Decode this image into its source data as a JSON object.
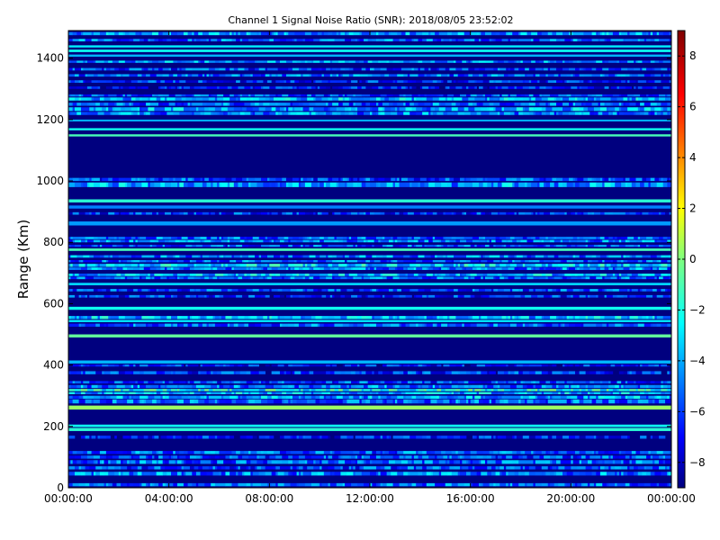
{
  "chart_data": {
    "type": "heatmap",
    "title": "Channel 1 Signal Noise Ratio (SNR): 2018/08/05 23:52:02",
    "xlabel": "",
    "ylabel": "Range (Km)",
    "x_tick_labels": [
      "00:00:00",
      "04:00:00",
      "08:00:00",
      "12:00:00",
      "16:00:00",
      "20:00:00",
      "00:00:00"
    ],
    "x_ticks_hours": [
      0,
      4,
      8,
      12,
      16,
      20,
      24
    ],
    "xlim_hours": [
      0,
      24
    ],
    "y_ticks": [
      0,
      200,
      400,
      600,
      800,
      1000,
      1200,
      1400
    ],
    "ylim": [
      0,
      1490
    ],
    "colorbar": {
      "colormap": "jet",
      "clim": [
        -9,
        9
      ],
      "ticks": [
        8,
        6,
        4,
        2,
        0,
        -2,
        -4,
        -6,
        -8
      ],
      "tick_labels": [
        "8",
        "6",
        "4",
        "2",
        "0",
        "−2",
        "−4",
        "−6",
        "−8"
      ]
    },
    "background_value": -8.8,
    "range_bands": [
      {
        "range": [
          5,
          15
        ],
        "value": -5.0,
        "variability": "high"
      },
      {
        "range": [
          40,
          52
        ],
        "value": -4.5,
        "variability": "high"
      },
      {
        "range": [
          60,
          70
        ],
        "value": -5.5,
        "variability": "high"
      },
      {
        "range": [
          78,
          90
        ],
        "value": -5.0,
        "variability": "high"
      },
      {
        "range": [
          95,
          105
        ],
        "value": -5.5,
        "variability": "high"
      },
      {
        "range": [
          110,
          120
        ],
        "value": -5.0,
        "variability": "high"
      },
      {
        "range": [
          160,
          170
        ],
        "value": -6.5,
        "variability": "high"
      },
      {
        "range": [
          185,
          195
        ],
        "value": -1.5,
        "variability": "low"
      },
      {
        "range": [
          198,
          206
        ],
        "value": -2.0,
        "variability": "low"
      },
      {
        "range": [
          255,
          268
        ],
        "value": 0.5,
        "variability": "low"
      },
      {
        "range": [
          275,
          288
        ],
        "value": -5.0,
        "variability": "high"
      },
      {
        "range": [
          290,
          300
        ],
        "value": -4.0,
        "variability": "high"
      },
      {
        "range": [
          305,
          312
        ],
        "value": -3.5,
        "variability": "high"
      },
      {
        "range": [
          315,
          322
        ],
        "value": -2.0,
        "variability": "high"
      },
      {
        "range": [
          325,
          335
        ],
        "value": -4.5,
        "variability": "high"
      },
      {
        "range": [
          340,
          348
        ],
        "value": -5.5,
        "variability": "high"
      },
      {
        "range": [
          370,
          380
        ],
        "value": -6.0,
        "variability": "high"
      },
      {
        "range": [
          395,
          402
        ],
        "value": -6.5,
        "variability": "high"
      },
      {
        "range": [
          405,
          415
        ],
        "value": -3.5,
        "variability": "low"
      },
      {
        "range": [
          490,
          500
        ],
        "value": -0.5,
        "variability": "low"
      },
      {
        "range": [
          525,
          535
        ],
        "value": -5.0,
        "variability": "high"
      },
      {
        "range": [
          540,
          547
        ],
        "value": -2.5,
        "variability": "low"
      },
      {
        "range": [
          550,
          560
        ],
        "value": -3.5,
        "variability": "high"
      },
      {
        "range": [
          580,
          590
        ],
        "value": -2.0,
        "variability": "low"
      },
      {
        "range": [
          620,
          628
        ],
        "value": -6.0,
        "variability": "high"
      },
      {
        "range": [
          640,
          648
        ],
        "value": -5.5,
        "variability": "high"
      },
      {
        "range": [
          660,
          668
        ],
        "value": -3.0,
        "variability": "low"
      },
      {
        "range": [
          680,
          688
        ],
        "value": -5.0,
        "variability": "high"
      },
      {
        "range": [
          690,
          698
        ],
        "value": -3.5,
        "variability": "high"
      },
      {
        "range": [
          710,
          718
        ],
        "value": -4.5,
        "variability": "high"
      },
      {
        "range": [
          720,
          730
        ],
        "value": -3.0,
        "variability": "high"
      },
      {
        "range": [
          735,
          742
        ],
        "value": -5.0,
        "variability": "high"
      },
      {
        "range": [
          750,
          758
        ],
        "value": -4.5,
        "variability": "high"
      },
      {
        "range": [
          772,
          780
        ],
        "value": -1.0,
        "variability": "low"
      },
      {
        "range": [
          785,
          792
        ],
        "value": -5.5,
        "variability": "high"
      },
      {
        "range": [
          800,
          808
        ],
        "value": -4.5,
        "variability": "high"
      },
      {
        "range": [
          810,
          818
        ],
        "value": -5.0,
        "variability": "high"
      },
      {
        "range": [
          855,
          868
        ],
        "value": -4.0,
        "variability": "low"
      },
      {
        "range": [
          890,
          898
        ],
        "value": -6.0,
        "variability": "high"
      },
      {
        "range": [
          910,
          920
        ],
        "value": -4.5,
        "variability": "low"
      },
      {
        "range": [
          930,
          940
        ],
        "value": -1.5,
        "variability": "low"
      },
      {
        "range": [
          980,
          995
        ],
        "value": -4.0,
        "variability": "high"
      },
      {
        "range": [
          1000,
          1010
        ],
        "value": -5.5,
        "variability": "high"
      },
      {
        "range": [
          1145,
          1152
        ],
        "value": -1.0,
        "variability": "low"
      },
      {
        "range": [
          1165,
          1172
        ],
        "value": -2.0,
        "variability": "low"
      },
      {
        "range": [
          1195,
          1200
        ],
        "value": -3.5,
        "variability": "low"
      },
      {
        "range": [
          1215,
          1225
        ],
        "value": -4.5,
        "variability": "high"
      },
      {
        "range": [
          1228,
          1240
        ],
        "value": -4.0,
        "variability": "high"
      },
      {
        "range": [
          1245,
          1255
        ],
        "value": -5.0,
        "variability": "high"
      },
      {
        "range": [
          1262,
          1272
        ],
        "value": -3.5,
        "variability": "high"
      },
      {
        "range": [
          1275,
          1282
        ],
        "value": -5.5,
        "variability": "high"
      },
      {
        "range": [
          1300,
          1308
        ],
        "value": -6.5,
        "variability": "high"
      },
      {
        "range": [
          1320,
          1328
        ],
        "value": -6.0,
        "variability": "high"
      },
      {
        "range": [
          1340,
          1348
        ],
        "value": -5.0,
        "variability": "high"
      },
      {
        "range": [
          1360,
          1368
        ],
        "value": -5.5,
        "variability": "high"
      },
      {
        "range": [
          1385,
          1392
        ],
        "value": -4.0,
        "variability": "high"
      },
      {
        "range": [
          1405,
          1412
        ],
        "value": -3.5,
        "variability": "low"
      },
      {
        "range": [
          1420,
          1428
        ],
        "value": -2.0,
        "variability": "low"
      },
      {
        "range": [
          1435,
          1442
        ],
        "value": -2.5,
        "variability": "low"
      },
      {
        "range": [
          1455,
          1463
        ],
        "value": -5.0,
        "variability": "high"
      },
      {
        "range": [
          1475,
          1485
        ],
        "value": -4.0,
        "variability": "high"
      }
    ]
  }
}
